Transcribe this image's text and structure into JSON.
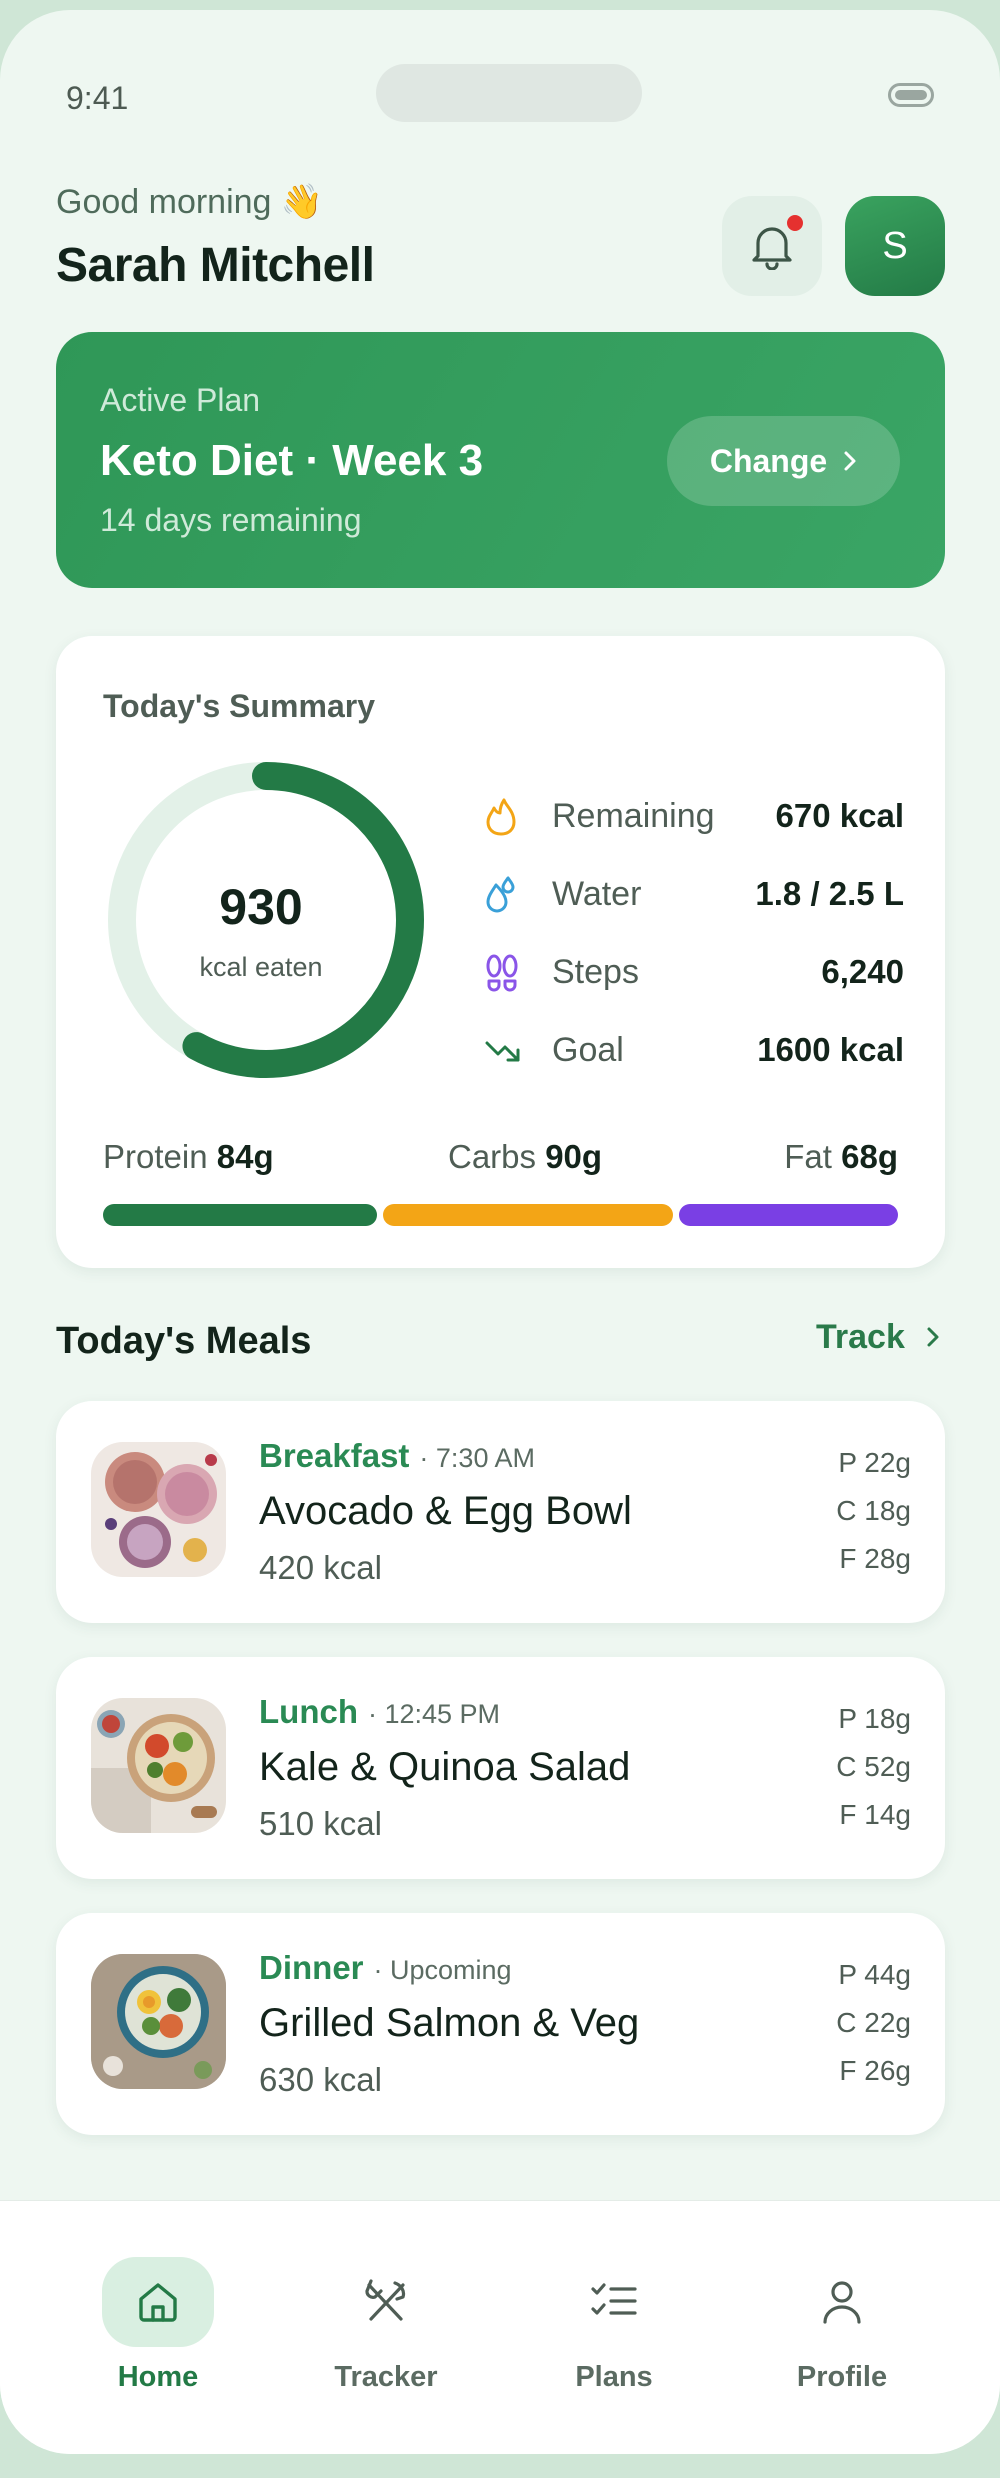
{
  "status": {
    "time": "9:41"
  },
  "header": {
    "greeting": "Good morning 👋",
    "name": "Sarah Mitchell",
    "avatar_initial": "S"
  },
  "plan": {
    "label": "Active Plan",
    "title": "Keto Diet · Week 3",
    "subtitle": "14 days remaining",
    "change_label": "Change"
  },
  "summary": {
    "title": "Today's Summary",
    "ring_value": "930",
    "ring_label": "kcal eaten",
    "ring_progress": 0.58,
    "stats": [
      {
        "label": "Remaining",
        "value": "670 kcal",
        "icon": "flame-icon"
      },
      {
        "label": "Water",
        "value": "1.8 / 2.5 L",
        "icon": "water-drop-icon"
      },
      {
        "label": "Steps",
        "value": "6,240",
        "icon": "footsteps-icon"
      },
      {
        "label": "Goal",
        "value": "1600 kcal",
        "icon": "trend-down-icon"
      }
    ],
    "macros": {
      "protein_label": "Protein",
      "protein_value": "84g",
      "carbs_label": "Carbs",
      "carbs_value": "90g",
      "fat_label": "Fat",
      "fat_value": "68g"
    },
    "colors": {
      "protein": "#237a46",
      "carbs": "#f3a516",
      "fat": "#7a3fe4"
    }
  },
  "meals_section": {
    "title": "Today's Meals",
    "track_label": "Track"
  },
  "meals": [
    {
      "type": "Breakfast",
      "time": "· 7:30 AM",
      "name": "Avocado & Egg Bowl",
      "kcal": "420 kcal",
      "p": "P 22g",
      "c": "C 18g",
      "f": "F 28g"
    },
    {
      "type": "Lunch",
      "time": "· 12:45 PM",
      "name": "Kale & Quinoa Salad",
      "kcal": "510 kcal",
      "p": "P 18g",
      "c": "C 52g",
      "f": "F 14g"
    },
    {
      "type": "Dinner",
      "time": "· Upcoming",
      "name": "Grilled Salmon & Veg",
      "kcal": "630 kcal",
      "p": "P 44g",
      "c": "C 22g",
      "f": "F 26g"
    }
  ],
  "nav": {
    "home": "Home",
    "tracker": "Tracker",
    "plans": "Plans",
    "profile": "Profile",
    "active": "Home"
  }
}
